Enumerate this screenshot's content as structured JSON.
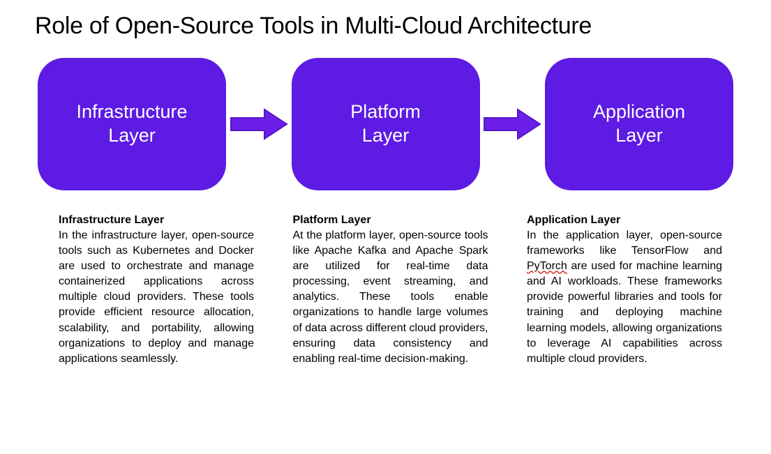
{
  "title": "Role of Open-Source Tools in Multi-Cloud Architecture",
  "layers": {
    "infrastructure": {
      "box_label": "Infrastructure\nLayer"
    },
    "platform": {
      "box_label": "Platform\nLayer"
    },
    "application": {
      "box_label": "Application\nLayer"
    }
  },
  "descriptions": {
    "infrastructure": {
      "heading": "Infrastructure Layer",
      "body": "In the infrastructure layer, open-source tools such as Kubernetes and Docker are used to orchestrate and manage containerized applications across multiple cloud providers. These tools provide efficient resource allocation, scalability, and portability, allowing organizations to deploy and manage applications seamlessly."
    },
    "platform": {
      "heading": "Platform Layer",
      "body": "At the platform layer, open-source tools like Apache Kafka and Apache Spark are utilized for real-time data processing, event streaming, and analytics. These tools enable organizations to handle large volumes of data across different cloud providers, ensuring data consistency and enabling real-time decision-making."
    },
    "application": {
      "heading": "Application Layer",
      "body_pre": "In the application layer, open-source frameworks like TensorFlow and ",
      "squiggle_word": "PyTorch",
      "body_post": " are used for machine learning and AI workloads. These frameworks provide powerful libraries and tools for training and deploying machine learning models, allowing organizations to leverage AI capabilities across multiple cloud providers."
    }
  },
  "colors": {
    "box_bg": "#5d1be3",
    "arrow_fill": "#6b1fe8",
    "arrow_stroke": "#5516c9"
  }
}
